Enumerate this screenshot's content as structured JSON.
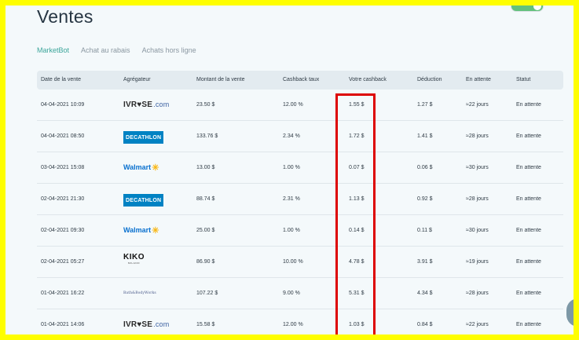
{
  "page": {
    "title": "Ventes"
  },
  "tabs": [
    {
      "label": "MarketBot",
      "active": true
    },
    {
      "label": "Achat au rabais",
      "active": false
    },
    {
      "label": "Achats hors ligne",
      "active": false
    }
  ],
  "colors": {
    "accent": "#3ba59a",
    "highlight": "#dd0000",
    "frame": "#fefe00"
  },
  "table": {
    "headers": [
      "Date de la vente",
      "Agrégateur",
      "Montant de la vente",
      "Cashback taux",
      "Votre cashback",
      "Déduction",
      "En attente",
      "Statut"
    ],
    "rows": [
      {
        "date": "04-04-2021 10:09",
        "aggregator": "ivrose",
        "amount": "23.50 $",
        "rate": "12.00 %",
        "cashback": "1.55 $",
        "deduction": "1.27 $",
        "pending": "≈22 jours",
        "status": "En attente"
      },
      {
        "date": "04-04-2021 08:50",
        "aggregator": "decathlon",
        "amount": "133.76 $",
        "rate": "2.34 %",
        "cashback": "1.72 $",
        "deduction": "1.41 $",
        "pending": "≈28 jours",
        "status": "En attente"
      },
      {
        "date": "03-04-2021 15:08",
        "aggregator": "walmart",
        "amount": "13.00 $",
        "rate": "1.00 %",
        "cashback": "0.07 $",
        "deduction": "0.06 $",
        "pending": "≈30 jours",
        "status": "En attente"
      },
      {
        "date": "02-04-2021 21:30",
        "aggregator": "decathlon",
        "amount": "88.74 $",
        "rate": "2.31 %",
        "cashback": "1.13 $",
        "deduction": "0.92 $",
        "pending": "≈28 jours",
        "status": "En attente"
      },
      {
        "date": "02-04-2021 09:30",
        "aggregator": "walmart",
        "amount": "25.00 $",
        "rate": "1.00 %",
        "cashback": "0.14 $",
        "deduction": "0.11 $",
        "pending": "≈30 jours",
        "status": "En attente"
      },
      {
        "date": "02-04-2021 05:27",
        "aggregator": "kiko",
        "amount": "86.90 $",
        "rate": "10.00 %",
        "cashback": "4.78 $",
        "deduction": "3.91 $",
        "pending": "≈19 jours",
        "status": "En attente"
      },
      {
        "date": "01-04-2021 16:22",
        "aggregator": "bathbodyworks",
        "amount": "107.22 $",
        "rate": "9.00 %",
        "cashback": "5.31 $",
        "deduction": "4.34 $",
        "pending": "≈28 jours",
        "status": "En attente"
      },
      {
        "date": "01-04-2021 14:06",
        "aggregator": "ivrose",
        "amount": "15.58 $",
        "rate": "12.00 %",
        "cashback": "1.03 $",
        "deduction": "0.84 $",
        "pending": "≈22 jours",
        "status": "En attente"
      }
    ]
  },
  "logos": {
    "ivrose": {
      "main": "IVR♥SE",
      "suffix": ".com"
    },
    "decathlon": {
      "text": "DECATHLON"
    },
    "walmart": {
      "text": "Walmart",
      "spark": "✳"
    },
    "kiko": {
      "main": "KIKO",
      "sub": "MILANO"
    },
    "bathbodyworks": {
      "text": "Bath&BodyWorks"
    }
  }
}
